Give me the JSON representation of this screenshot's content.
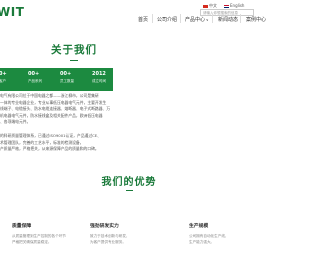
{
  "header": {
    "logo_text": "WIT",
    "lang_cn": "中文",
    "lang_en": "English",
    "search_placeholder": "请输入你想搜索的信息",
    "nav": [
      "首页",
      "公司介绍",
      "产品中心",
      "新闻动态",
      "案例中心"
    ],
    "nav_dropdown_glyph": "∨"
  },
  "about": {
    "title": "关于我们",
    "stats": [
      {
        "num": "0+",
        "label": "客户"
      },
      {
        "num": "00+",
        "label": "产品系列"
      },
      {
        "num": "00+",
        "label": "员工数量"
      },
      {
        "num": "2012",
        "label": "成立时间"
      }
    ],
    "para1": [
      "电气有限公司位于中国电器之都——浙江柳市，公司是集研",
      "一体的专业电器企业，专业从事低压电器电气元件，主要开发生",
      "线端子、电缆接头、防水电缆连接器、熔断器、电子式断路器、万",
      "机电器电气元件，防水接线盒及相关配件产品，欧洲低压电器",
      "、各项端电元件。"
    ],
    "para2": [
      "的科研质量管理体系，已通过ISO9001认证，产品通过CE、",
      "术管理团队，完善的工艺水平，标准的检测设备，",
      "产质量严格，严格把关，从来源保障产品的质量和的口碑。"
    ]
  },
  "advantages": {
    "title": "我们的优势",
    "cards": [
      {
        "title": "质量保障",
        "desc": [
          "从质量管理到生产控制的各个环节",
          "严格把关确保质量稳定。"
        ]
      },
      {
        "title": "强劲研发实力",
        "desc": [
          "致力于技术创新与研发，",
          "为客户提供专业服务。"
        ]
      },
      {
        "title": "生产规模",
        "desc": [
          "公司拥有自动化生产线，",
          "生产能力强大。"
        ]
      }
    ]
  },
  "colors": {
    "brand_green": "#1a7a3a",
    "stats_bg": "#1c8a40"
  }
}
